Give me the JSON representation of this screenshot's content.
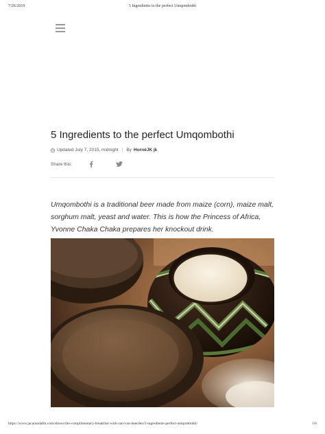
{
  "pdf_header": {
    "date": "7/26/2019",
    "doc_title": "5 Ingredients to the perfect Umqombothi"
  },
  "nav": {
    "menu_icon": "hamburger-menu-icon"
  },
  "article": {
    "title": "5 Ingredients to the perfect Umqombothi",
    "updated": "Updated July 7, 2015, midnight",
    "by_label": "By",
    "author": "HornéJK jk",
    "share_label": "Share this:",
    "share_icons": [
      "facebook-icon",
      "twitter-icon"
    ],
    "intro": "Umqombothi is a traditional beer made from maize (corn), maize malt, sorghum malt, yeast and water. This is how the Princess of Africa, Yvonne Chaka Chaka prepares her knockout drink."
  },
  "pdf_footer": {
    "url": "https://www.jacarandafm.com/shows/the-complimentary-breakfast-with-zan-van-heerden/5-ingredients-perfect-umqombothi/",
    "page": "1/6"
  },
  "colors": {
    "text": "#222222",
    "muted": "#555555",
    "icon": "#9a9a9a"
  }
}
